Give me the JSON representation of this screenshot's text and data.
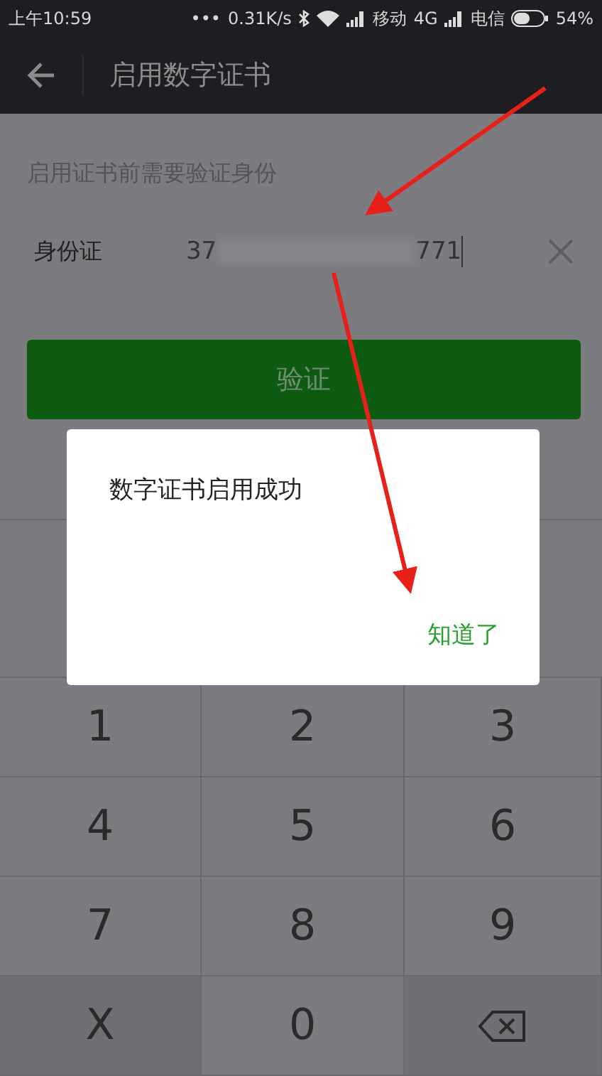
{
  "status_bar": {
    "time": "上午10:59",
    "dots": "•••",
    "speed": "0.31K/s",
    "carrier_1": "移动",
    "network_1": "4G",
    "carrier_2": "电信",
    "battery": "54%"
  },
  "app_bar": {
    "title": "启用数字证书"
  },
  "hint": "启用证书前需要验证身份",
  "id_field": {
    "label": "身份证",
    "value_start": "37",
    "value_end": "771",
    "masked": true
  },
  "verify_button": {
    "label": "验证"
  },
  "keypad": [
    {
      "kind": "digit",
      "label": "1"
    },
    {
      "kind": "digit",
      "label": "2"
    },
    {
      "kind": "digit",
      "label": "3"
    },
    {
      "kind": "digit",
      "label": "4"
    },
    {
      "kind": "digit",
      "label": "5"
    },
    {
      "kind": "digit",
      "label": "6"
    },
    {
      "kind": "digit",
      "label": "7"
    },
    {
      "kind": "digit",
      "label": "8"
    },
    {
      "kind": "digit",
      "label": "9"
    },
    {
      "kind": "side",
      "label": "X"
    },
    {
      "kind": "digit",
      "label": "0"
    },
    {
      "kind": "delete"
    }
  ],
  "dialog": {
    "message": "数字证书启用成功",
    "action": "知道了"
  }
}
